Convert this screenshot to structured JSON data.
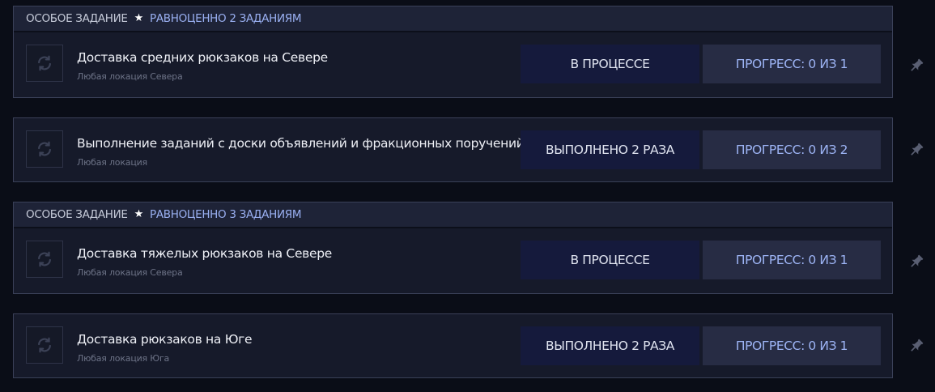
{
  "groups": [
    {
      "special": true,
      "special_label": "ОСОБОЕ ЗАДАНИЕ",
      "equiv_label": "РАВНОЦЕННО 2 ЗАДАНИЯМ",
      "quest": {
        "title": "Доставка средних рюкзаков на Севере",
        "subtitle": "Любая локация Севера",
        "status": "В ПРОЦЕССЕ",
        "progress": "ПРОГРЕСС: 0 ИЗ 1"
      }
    },
    {
      "special": false,
      "quest": {
        "title": "Выполнение заданий с доски объявлений и фракционных поручений",
        "subtitle": "Любая локация",
        "status": "ВЫПОЛНЕНО 2 РАЗА",
        "progress": "ПРОГРЕСС: 0 ИЗ 2"
      }
    },
    {
      "special": true,
      "special_label": "ОСОБОЕ ЗАДАНИЕ",
      "equiv_label": "РАВНОЦЕННО 3 ЗАДАНИЯМ",
      "quest": {
        "title": "Доставка тяжелых рюкзаков на Севере",
        "subtitle": "Любая локация Севера",
        "status": "В ПРОЦЕССЕ",
        "progress": "ПРОГРЕСС: 0 ИЗ 1"
      }
    },
    {
      "special": false,
      "quest": {
        "title": "Доставка рюкзаков на Юге",
        "subtitle": "Любая локация Юга",
        "status": "ВЫПОЛНЕНО 2 РАЗА",
        "progress": "ПРОГРЕСС: 0 ИЗ 1"
      }
    }
  ],
  "icons": {
    "special_star": "star-icon",
    "refresh": "refresh-icon",
    "pin": "pin-icon"
  },
  "colors": {
    "status_bg": "#151a3c",
    "progress_text": "#9db4f5",
    "equiv_text": "#9ab0f2"
  }
}
